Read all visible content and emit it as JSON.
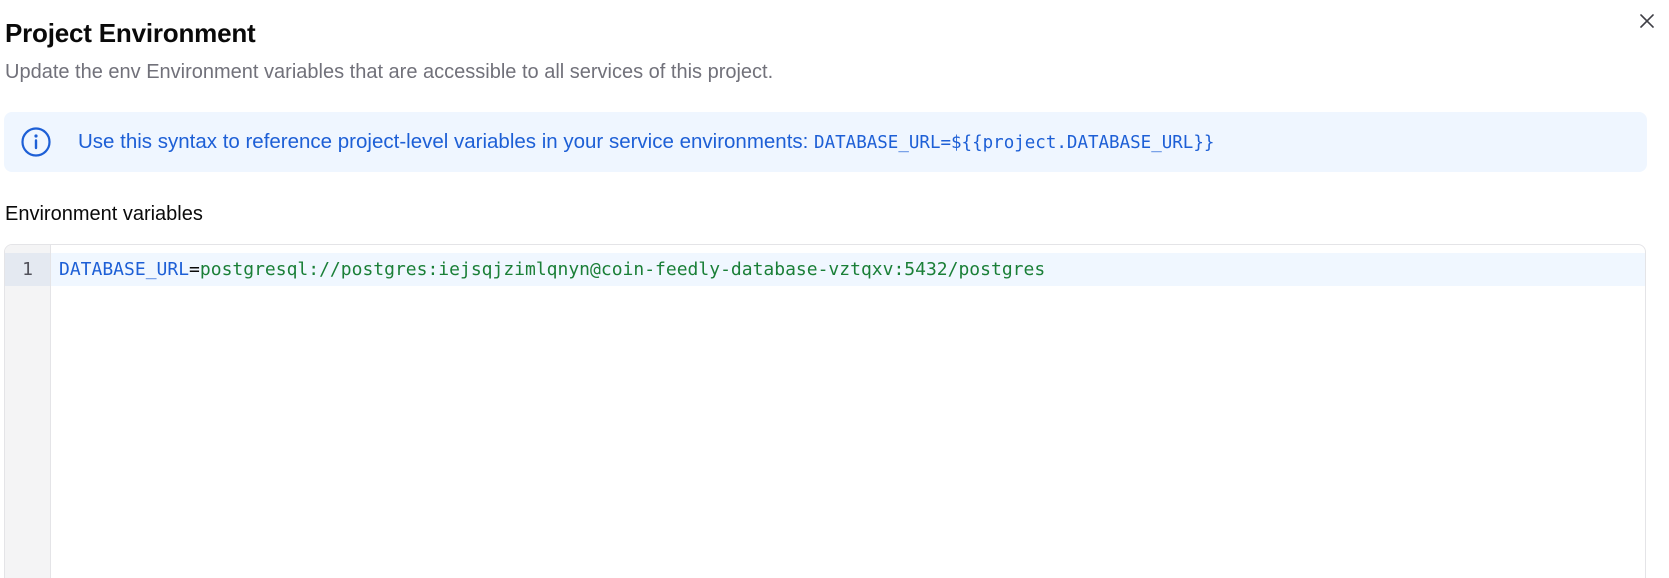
{
  "dialog": {
    "title": "Project Environment",
    "description": "Update the env Environment variables that are accessible to all services of this project.",
    "close_icon": "close-icon"
  },
  "alert": {
    "icon": "info-icon",
    "text": "Use this syntax to reference project-level variables in your service environments: ",
    "code": "DATABASE_URL=${{project.DATABASE_URL}}"
  },
  "env_section": {
    "label": "Environment variables"
  },
  "editor": {
    "lines": [
      {
        "number": "1",
        "key": "DATABASE_URL",
        "operator": "=",
        "value": "postgresql://postgres:iejsqjzimlqnyn@coin-feedly-database-vztqxv:5432/postgres"
      }
    ]
  },
  "colors": {
    "accent_blue": "#1d5fd6",
    "alert_bg": "#eff6ff",
    "value_green": "#1a7f37"
  }
}
